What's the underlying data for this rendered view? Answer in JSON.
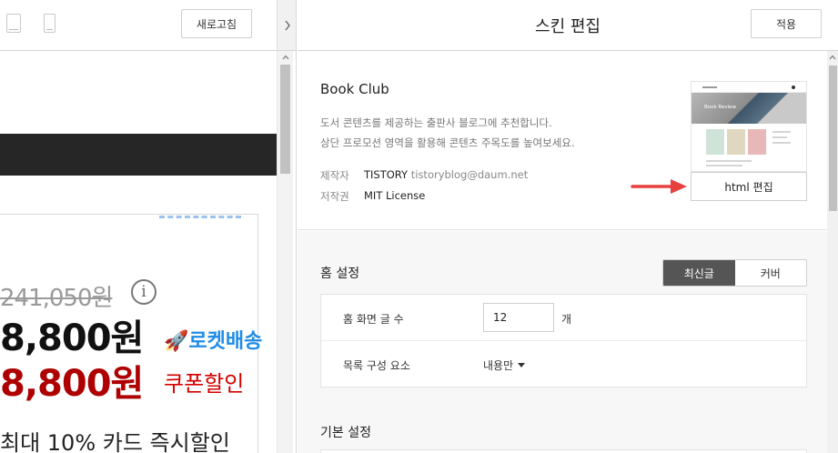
{
  "left_toolbar": {
    "desktop_view_icon": "desktop-view-icon",
    "mobile_view_icon": "mobile-view-icon",
    "refresh_label": "새로고침",
    "collapse_icon": "chevron-right-icon"
  },
  "preview": {
    "old_price": "241,050원",
    "info_icon": "i",
    "price": "8,800원",
    "rocket_label": "🚀로켓배송",
    "coupon_price": "8,800원",
    "coupon_label": "쿠폰할인",
    "card_discount": "최대 10% 카드 즉시할인"
  },
  "editor": {
    "title": "스킨 편집",
    "apply_label": "적용"
  },
  "skin": {
    "name": "Book Club",
    "desc_line1": "도서 콘텐츠를 제공하는 출판사 블로그에 추천합니다.",
    "desc_line2": "상단 프로모션 영역을 활용해 콘텐츠 주목도를 높여보세요.",
    "maker_label": "제작자",
    "maker_name": "TISTORY",
    "maker_email": "tistoryblog@daum.net",
    "license_label": "저작권",
    "license_value": "MIT License",
    "html_edit_label": "html 편집",
    "thumbnail_text": "Book Review"
  },
  "home_settings": {
    "title": "홈 설정",
    "toggle_options": [
      "최신글",
      "커버"
    ],
    "selected_option": "최신글",
    "posts_label": "홈 화면 글 수",
    "posts_value": "12",
    "posts_unit": "개",
    "list_label": "목록 구성 요소",
    "list_value": "내용만"
  },
  "basic_settings": {
    "title": "기본 설정"
  },
  "colors": {
    "annotation_arrow": "#e8413d",
    "toggle_active_bg": "#555555",
    "coupon_red": "#ae0000",
    "rocket_blue": "#1f8ce6"
  }
}
